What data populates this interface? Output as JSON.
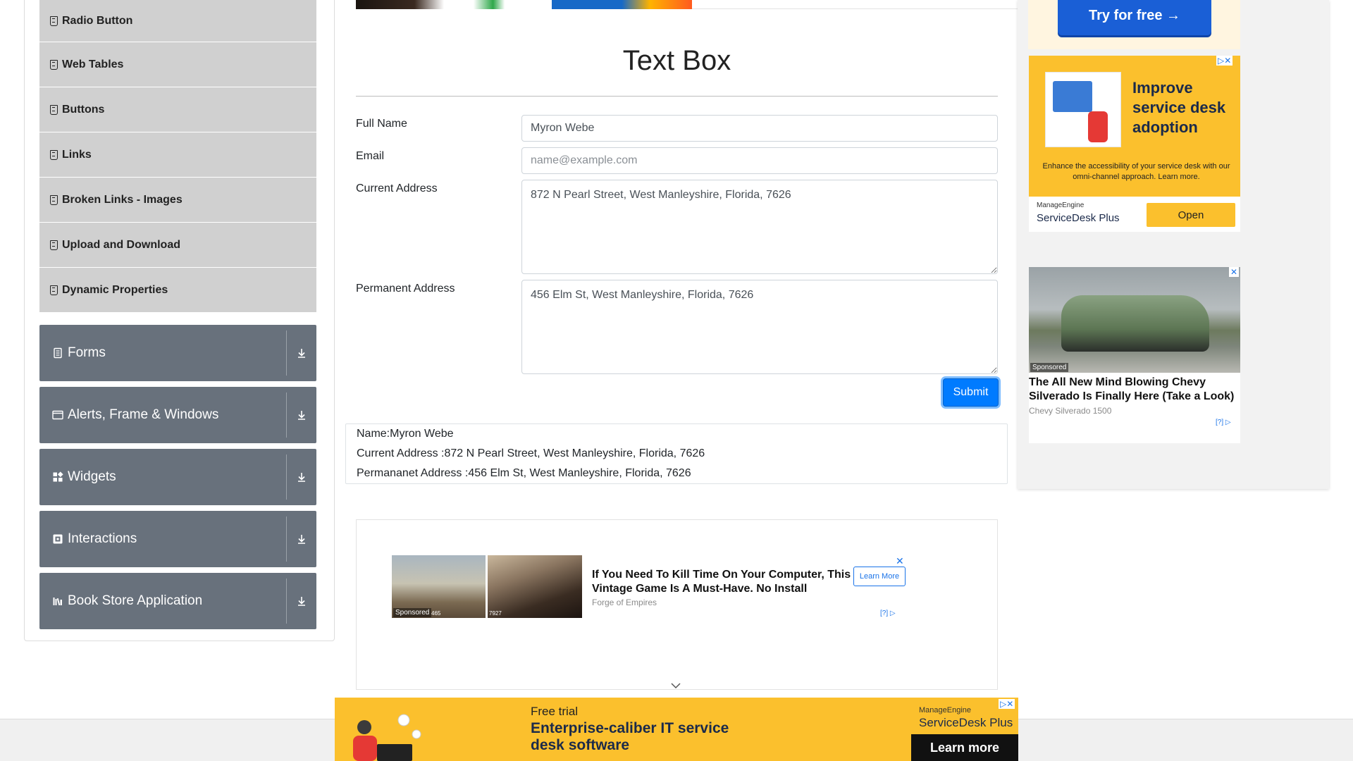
{
  "sidebar": {
    "elements_items": [
      {
        "label": "Radio Button"
      },
      {
        "label": "Web Tables"
      },
      {
        "label": "Buttons"
      },
      {
        "label": "Links"
      },
      {
        "label": "Broken Links - Images"
      },
      {
        "label": "Upload and Download"
      },
      {
        "label": "Dynamic Properties"
      }
    ],
    "groups": [
      {
        "label": "Forms",
        "icon": "form-icon"
      },
      {
        "label": "Alerts, Frame & Windows",
        "icon": "window-icon"
      },
      {
        "label": "Widgets",
        "icon": "widgets-icon"
      },
      {
        "label": "Interactions",
        "icon": "interactions-icon"
      },
      {
        "label": "Book Store Application",
        "icon": "book-icon"
      }
    ]
  },
  "main": {
    "title": "Text Box",
    "form": {
      "full_name_label": "Full Name",
      "full_name_value": "Myron Webe",
      "email_label": "Email",
      "email_placeholder": "name@example.com",
      "current_address_label": "Current Address",
      "current_address_value": "872 N Pearl Street, West Manleyshire, Florida, 7626",
      "permanent_address_label": "Permanent Address",
      "permanent_address_value": "456 Elm St, West Manleyshire, Florida, 7626",
      "submit_label": "Submit"
    },
    "output": {
      "name": "Name:Myron Webe",
      "current_address": "Current Address :872 N Pearl Street, West Manleyshire, Florida, 7626",
      "permanent_address": "Permananet Address :456 Elm St, West Manleyshire, Florida, 7626"
    }
  },
  "ads": {
    "mid": {
      "sponsored": "Sponsored",
      "img1_num": "465",
      "img2_num": "7927",
      "headline": "If You Need To Kill Time On Your Computer, This Vintage Game Is A Must-Have. No Install",
      "brand": "Forge of Empires",
      "cta": "Learn More",
      "info": "[?]"
    },
    "rail_top": {
      "cta": "Try for free →"
    },
    "servicedesk": {
      "headline": "Improve service desk adoption",
      "sub": "Enhance the accessibility of your service desk with our omni-channel approach. Learn more.",
      "company": "ManageEngine",
      "product": "ServiceDesk Plus",
      "cta": "Open"
    },
    "car": {
      "sponsored": "Sponsored",
      "headline": "The All New Mind Blowing Chevy Silverado Is Finally Here (Take a Look)",
      "brand": "Chevy Silverado 1500",
      "info": "[?]"
    },
    "bottom": {
      "free_trial": "Free trial",
      "headline": "Enterprise-caliber IT service desk software",
      "company": "ManageEngine",
      "product": "ServiceDesk Plus",
      "cta": "Learn more"
    }
  },
  "colors": {
    "group_bg": "#68717c",
    "submenu_bg": "#d0d0d0",
    "primary": "#007bff",
    "ad_yellow": "#fbc02d"
  }
}
